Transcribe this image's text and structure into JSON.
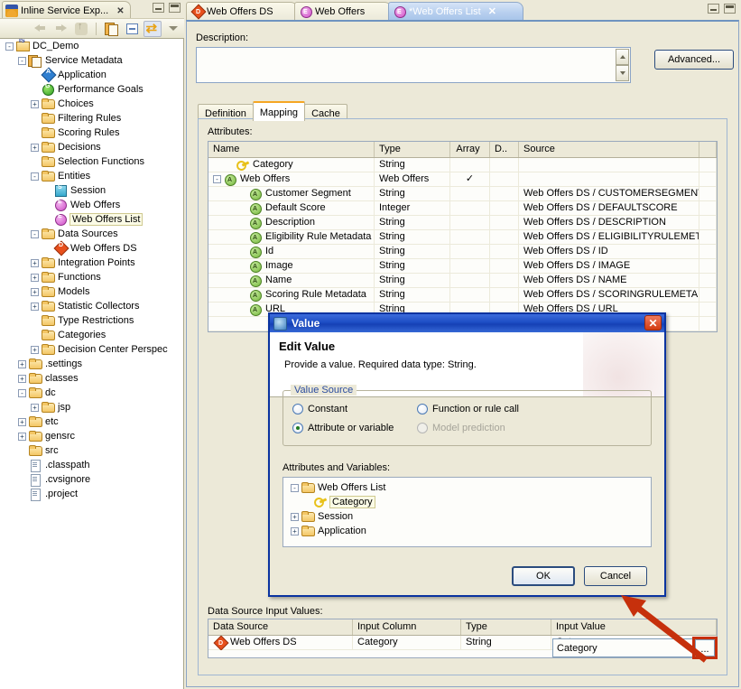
{
  "left_view": {
    "tab_label": "Inline Service Exp...",
    "tab_icon": "inline-service-icon",
    "close_glyph": "✕",
    "toolbar": {
      "back": "back-arrow-icon",
      "forward": "forward-arrow-icon",
      "up": "up-arrow-icon",
      "copy": "copy-icon",
      "collapse_all": "collapse-all-icon",
      "link_with_editor": "link-with-editor-icon",
      "view_menu": "view-menu-icon"
    },
    "tree": [
      {
        "label": "DC_Demo",
        "depth": 0,
        "icon": "project-icon",
        "expander": "-"
      },
      {
        "label": "Service Metadata",
        "depth": 1,
        "icon": "service-metadata-icon",
        "expander": "-"
      },
      {
        "label": "Application",
        "depth": 2,
        "icon": "application-icon",
        "expander": ""
      },
      {
        "label": "Performance Goals",
        "depth": 2,
        "icon": "performance-goal-icon",
        "expander": ""
      },
      {
        "label": "Choices",
        "depth": 2,
        "icon": "folder-icon",
        "expander": "+"
      },
      {
        "label": "Filtering Rules",
        "depth": 2,
        "icon": "folder-icon",
        "expander": ""
      },
      {
        "label": "Scoring Rules",
        "depth": 2,
        "icon": "folder-icon",
        "expander": ""
      },
      {
        "label": "Decisions",
        "depth": 2,
        "icon": "folder-icon",
        "expander": "+"
      },
      {
        "label": "Selection Functions",
        "depth": 2,
        "icon": "folder-icon",
        "expander": ""
      },
      {
        "label": "Entities",
        "depth": 2,
        "icon": "folder-icon",
        "expander": "-"
      },
      {
        "label": "Session",
        "depth": 3,
        "icon": "session-icon",
        "expander": ""
      },
      {
        "label": "Web Offers",
        "depth": 3,
        "icon": "entity-icon",
        "expander": ""
      },
      {
        "label": "Web Offers List",
        "depth": 3,
        "icon": "entity-icon",
        "expander": "",
        "selected": true
      },
      {
        "label": "Data Sources",
        "depth": 2,
        "icon": "folder-icon",
        "expander": "-"
      },
      {
        "label": "Web Offers DS",
        "depth": 3,
        "icon": "datasource-icon",
        "expander": ""
      },
      {
        "label": "Integration Points",
        "depth": 2,
        "icon": "folder-icon",
        "expander": "+"
      },
      {
        "label": "Functions",
        "depth": 2,
        "icon": "folder-icon",
        "expander": "+"
      },
      {
        "label": "Models",
        "depth": 2,
        "icon": "folder-icon",
        "expander": "+"
      },
      {
        "label": "Statistic Collectors",
        "depth": 2,
        "icon": "folder-icon",
        "expander": "+"
      },
      {
        "label": "Type Restrictions",
        "depth": 2,
        "icon": "folder-icon",
        "expander": ""
      },
      {
        "label": "Categories",
        "depth": 2,
        "icon": "folder-icon",
        "expander": ""
      },
      {
        "label": "Decision Center Perspec",
        "depth": 2,
        "icon": "folder-icon",
        "expander": "+"
      },
      {
        "label": ".settings",
        "depth": 1,
        "icon": "folder-icon",
        "expander": "+"
      },
      {
        "label": "classes",
        "depth": 1,
        "icon": "folder-icon",
        "expander": "+"
      },
      {
        "label": "dc",
        "depth": 1,
        "icon": "folder-icon",
        "expander": "-"
      },
      {
        "label": "jsp",
        "depth": 2,
        "icon": "folder-icon",
        "expander": "+"
      },
      {
        "label": "etc",
        "depth": 1,
        "icon": "folder-icon",
        "expander": "+"
      },
      {
        "label": "gensrc",
        "depth": 1,
        "icon": "folder-icon",
        "expander": "+"
      },
      {
        "label": "src",
        "depth": 1,
        "icon": "folder-icon",
        "expander": ""
      },
      {
        "label": ".classpath",
        "depth": 1,
        "icon": "file-icon",
        "expander": ""
      },
      {
        "label": ".cvsignore",
        "depth": 1,
        "icon": "file-icon",
        "expander": ""
      },
      {
        "label": ".project",
        "depth": 1,
        "icon": "file-icon",
        "expander": ""
      }
    ]
  },
  "editor": {
    "tabs": [
      {
        "label": "Web Offers DS",
        "icon": "datasource-icon",
        "active": false,
        "dirty": false
      },
      {
        "label": "Web Offers",
        "icon": "entity-icon",
        "active": false,
        "dirty": false
      },
      {
        "label": "*Web Offers List",
        "icon": "entity-icon",
        "active": true,
        "dirty": true,
        "close_glyph": "✕"
      }
    ],
    "description_label": "Description:",
    "description_value": "",
    "advanced_label": "Advanced...",
    "inner_tabs": [
      {
        "label": "Definition",
        "active": false
      },
      {
        "label": "Mapping",
        "active": true
      },
      {
        "label": "Cache",
        "active": false
      }
    ],
    "attributes_label": "Attributes:",
    "attributes_columns": [
      "Name",
      "Type",
      "Array",
      "D..",
      "Source",
      ""
    ],
    "attributes_rows": [
      {
        "name": "Category",
        "type": "String",
        "array": "",
        "d": "",
        "source": "",
        "icon": "key-icon",
        "indent": 1,
        "expander": ""
      },
      {
        "name": "Web Offers",
        "type": "Web Offers",
        "array": "✓",
        "d": "",
        "source": "",
        "icon": "attribute-icon",
        "indent": 0,
        "expander": "-"
      },
      {
        "name": "Customer Segment",
        "type": "String",
        "array": "",
        "d": "",
        "source": "Web Offers DS / CUSTOMERSEGMENT",
        "icon": "attribute-icon",
        "indent": 2,
        "expander": ""
      },
      {
        "name": "Default Score",
        "type": "Integer",
        "array": "",
        "d": "",
        "source": "Web Offers DS / DEFAULTSCORE",
        "icon": "attribute-icon",
        "indent": 2,
        "expander": ""
      },
      {
        "name": "Description",
        "type": "String",
        "array": "",
        "d": "",
        "source": "Web Offers DS / DESCRIPTION",
        "icon": "attribute-icon",
        "indent": 2,
        "expander": ""
      },
      {
        "name": "Eligibility Rule Metadata",
        "type": "String",
        "array": "",
        "d": "",
        "source": "Web Offers DS / ELIGIBILITYRULEMETADATA",
        "icon": "attribute-icon",
        "indent": 2,
        "expander": ""
      },
      {
        "name": "Id",
        "type": "String",
        "array": "",
        "d": "",
        "source": "Web Offers DS / ID",
        "icon": "attribute-icon",
        "indent": 2,
        "expander": ""
      },
      {
        "name": "Image",
        "type": "String",
        "array": "",
        "d": "",
        "source": "Web Offers DS / IMAGE",
        "icon": "attribute-icon",
        "indent": 2,
        "expander": ""
      },
      {
        "name": "Name",
        "type": "String",
        "array": "",
        "d": "",
        "source": "Web Offers DS / NAME",
        "icon": "attribute-icon",
        "indent": 2,
        "expander": ""
      },
      {
        "name": "Scoring Rule Metadata",
        "type": "String",
        "array": "",
        "d": "",
        "source": "Web Offers DS / SCORINGRULEMETADATA",
        "icon": "attribute-icon",
        "indent": 2,
        "expander": ""
      },
      {
        "name": "URL",
        "type": "String",
        "array": "",
        "d": "",
        "source": "Web Offers DS / URL",
        "icon": "attribute-icon",
        "indent": 2,
        "expander": ""
      }
    ],
    "dsiv_label": "Data Source Input Values:",
    "dsiv_columns": [
      "Data Source",
      "Input Column",
      "Type",
      "Input Value"
    ],
    "dsiv_rows": [
      {
        "data_source": "Web Offers DS",
        "input_column": "Category",
        "type": "String",
        "input_value": "Category",
        "icon": "datasource-icon"
      }
    ],
    "ellipsis_label": "..."
  },
  "dialog": {
    "title": "Value",
    "title_icon": "value-dialog-icon",
    "close_glyph": "✕",
    "heading": "Edit Value",
    "subtext": "Provide a value. Required data type: String.",
    "group_label": "Value Source",
    "radios": [
      {
        "label": "Constant",
        "selected": false,
        "disabled": false
      },
      {
        "label": "Function or rule call",
        "selected": false,
        "disabled": false
      },
      {
        "label": "Attribute or variable",
        "selected": true,
        "disabled": false
      },
      {
        "label": "Model prediction",
        "selected": false,
        "disabled": true
      }
    ],
    "tree_label": "Attributes and Variables:",
    "tree": [
      {
        "label": "Web Offers List",
        "depth": 0,
        "icon": "folder-icon",
        "expander": "-",
        "selected": false
      },
      {
        "label": "Category",
        "depth": 1,
        "icon": "key-icon",
        "expander": "",
        "selected": true
      },
      {
        "label": "Session",
        "depth": 0,
        "icon": "folder-icon",
        "expander": "+",
        "selected": false
      },
      {
        "label": "Application",
        "depth": 0,
        "icon": "folder-icon",
        "expander": "+",
        "selected": false
      }
    ],
    "ok_label": "OK",
    "cancel_label": "Cancel"
  },
  "window_controls": {
    "minimize": "minimize-icon",
    "maximize": "maximize-icon"
  },
  "colors": {
    "annotation": "#c6300c",
    "dialog_titlebar": "#1540b5",
    "active_tab": "#a8c5ea",
    "accent_orange": "#f5a623"
  }
}
